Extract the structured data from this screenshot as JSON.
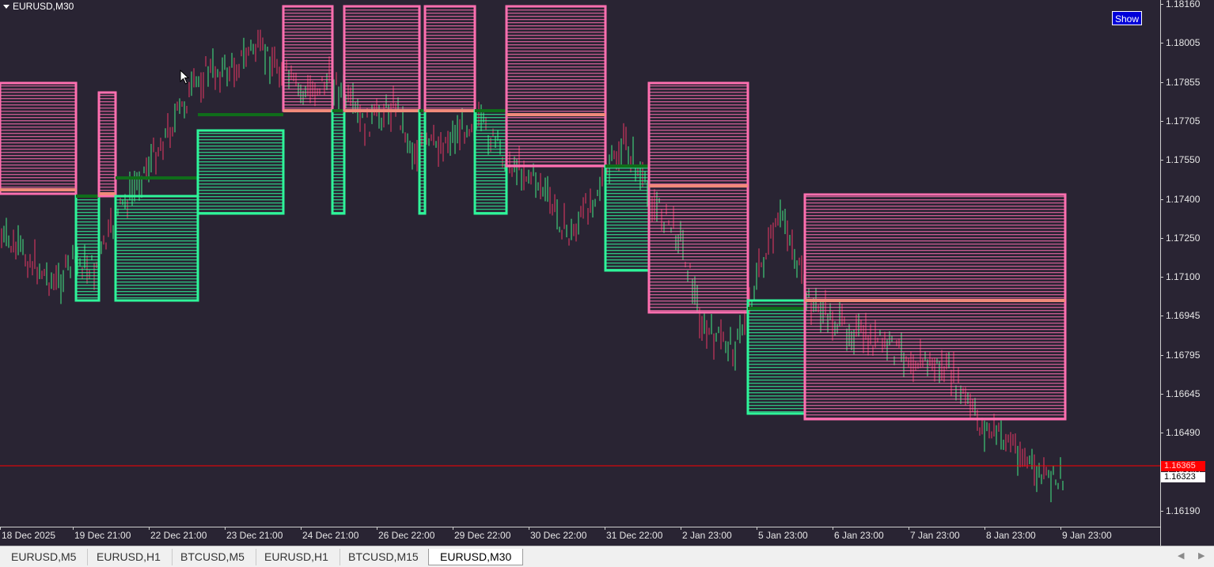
{
  "chart": {
    "symbol": "EURUSD,M30",
    "show_button": "Show",
    "ask_price": "1.16365",
    "bid_price": "1.16323",
    "price_ticks": [
      "1.18160",
      "1.18005",
      "1.17855",
      "1.17705",
      "1.17550",
      "1.17400",
      "1.17250",
      "1.17100",
      "1.16945",
      "1.16795",
      "1.16645",
      "1.16490",
      "1.16340",
      "1.16190"
    ],
    "time_ticks": [
      "18 Dec 2025",
      "19 Dec 21:00",
      "22 Dec 21:00",
      "23 Dec 21:00",
      "24 Dec 21:00",
      "26 Dec 22:00",
      "29 Dec 22:00",
      "30 Dec 22:00",
      "31 Dec 22:00",
      "2 Jan 23:00",
      "5 Jan 23:00",
      "6 Jan 23:00",
      "7 Jan 23:00",
      "8 Jan 23:00",
      "9 Jan 23:00"
    ],
    "colors": {
      "background": "#292433",
      "bear_zone": "#ff6fb0",
      "bull_zone": "#2ef59a",
      "bear_mid": "#f08a7a",
      "bull_mid": "#0f6d1a",
      "price_line": "#ff0000"
    }
  },
  "tabs": [
    {
      "label": "EURUSD,M5",
      "active": false
    },
    {
      "label": "EURUSD,H1",
      "active": false
    },
    {
      "label": "BTCUSD,M5",
      "active": false
    },
    {
      "label": "EURUSD,H1",
      "active": false
    },
    {
      "label": "BTCUSD,M15",
      "active": false
    },
    {
      "label": "EURUSD,M30",
      "active": true
    }
  ],
  "icons": {
    "symbol_menu": "triangle-down-icon",
    "scroll_left": "chevron-left-icon",
    "scroll_right": "chevron-right-icon",
    "mouse_cursor": "arrow-cursor-icon"
  }
}
